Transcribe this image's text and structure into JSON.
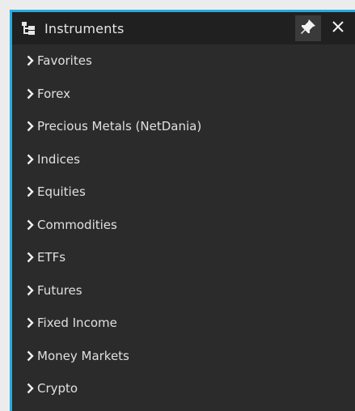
{
  "panel": {
    "title": "Instruments",
    "title_icon": "tree-structure-icon",
    "pin_icon": "pin-icon",
    "close_icon": "close-icon",
    "accent_color": "#29a9df",
    "items": [
      {
        "label": "Favorites",
        "icon": "chevron-right-icon"
      },
      {
        "label": "Forex",
        "icon": "chevron-right-icon"
      },
      {
        "label": "Precious Metals (NetDania)",
        "icon": "chevron-right-icon"
      },
      {
        "label": "Indices",
        "icon": "chevron-right-icon"
      },
      {
        "label": "Equities",
        "icon": "chevron-right-icon"
      },
      {
        "label": "Commodities",
        "icon": "chevron-right-icon"
      },
      {
        "label": "ETFs",
        "icon": "chevron-right-icon"
      },
      {
        "label": "Futures",
        "icon": "chevron-right-icon"
      },
      {
        "label": "Fixed Income",
        "icon": "chevron-right-icon"
      },
      {
        "label": "Money Markets",
        "icon": "chevron-right-icon"
      },
      {
        "label": "Crypto",
        "icon": "chevron-right-icon"
      }
    ]
  }
}
